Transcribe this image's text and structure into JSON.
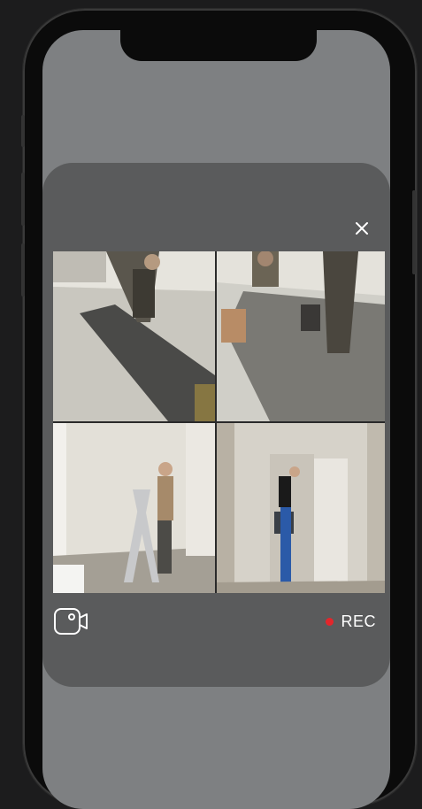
{
  "modal": {
    "close_icon": "close-icon",
    "cameras": [
      {
        "icon": "camera-feed"
      },
      {
        "icon": "camera-feed"
      },
      {
        "icon": "camera-feed"
      },
      {
        "icon": "camera-feed"
      }
    ],
    "switch_camera_icon": "video-camera-icon",
    "rec": {
      "label": "REC",
      "dot_color": "#e3262b"
    }
  },
  "colors": {
    "screen_bg": "#7e8082",
    "modal_bg": "#5a5b5c",
    "frame": "#0b0b0b"
  }
}
